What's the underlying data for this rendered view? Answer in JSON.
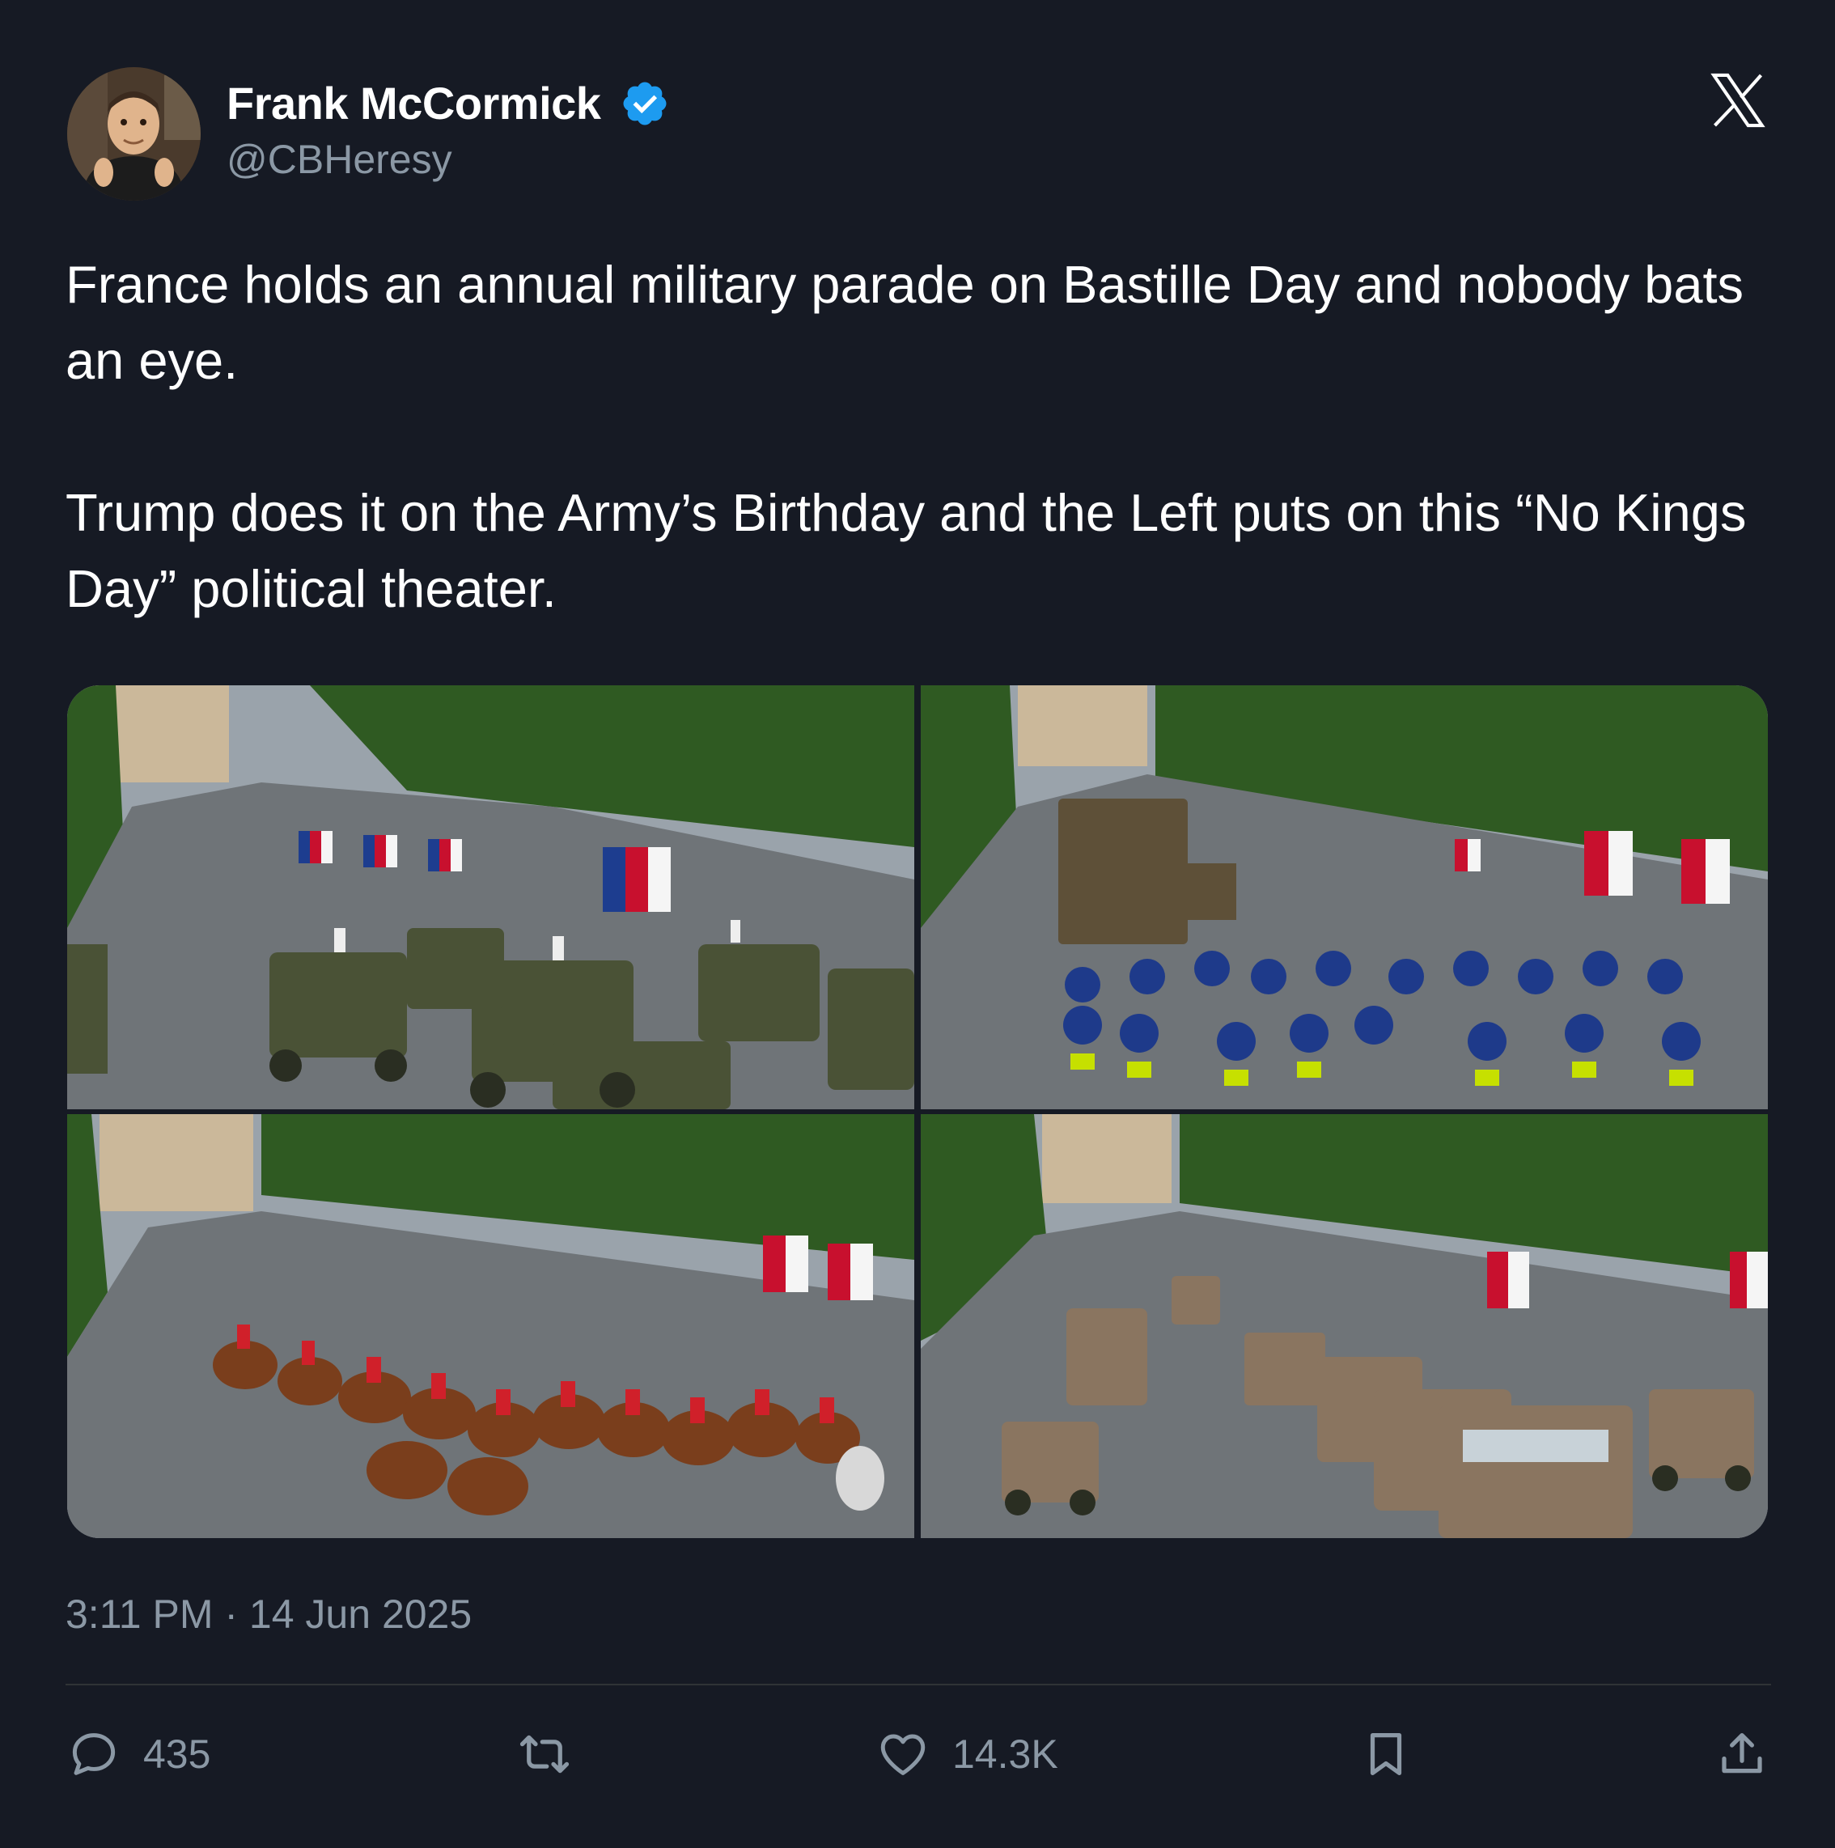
{
  "author": {
    "display_name": "Frank McCormick",
    "handle": "@CBHeresy",
    "verified_badge": "verified-badge-icon",
    "avatar_icon": "avatar"
  },
  "platform_logo": "x-logo-icon",
  "tweet": {
    "text": "France holds an annual military parade on Bastille Day and nobody bats an eye.\n\nTrump does it on the Army’s Birthday and the Left puts on this “No Kings Day” political theater."
  },
  "media": {
    "photos": [
      {
        "icon": "parade-photo-armored-vehicles"
      },
      {
        "icon": "parade-photo-police-motorcycles"
      },
      {
        "icon": "parade-photo-cavalry"
      },
      {
        "icon": "parade-photo-military-trucks"
      }
    ]
  },
  "timestamp": "3:11 PM · 14 Jun 2025",
  "actions": {
    "reply_count": "435",
    "like_count": "14.3K"
  },
  "colors": {
    "background": "#161a24",
    "text": "#ffffff",
    "secondary_text": "#8b98a5",
    "verified": "#1d9bf0"
  }
}
